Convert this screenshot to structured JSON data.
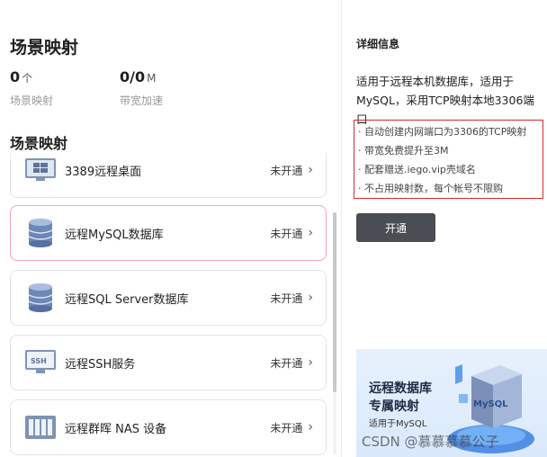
{
  "header": {
    "title": "场景映射"
  },
  "stats": [
    {
      "value": "0",
      "unit": "个",
      "label": "场景映射"
    },
    {
      "value": "0/0",
      "unit": "M",
      "label": "带宽加速"
    }
  ],
  "section": {
    "title": "场景映射"
  },
  "scenarios": [
    {
      "name": "3389远程桌面",
      "status": "未开通",
      "icon": "windows-icon"
    },
    {
      "name": "远程MySQL数据库",
      "status": "未开通",
      "icon": "database-icon"
    },
    {
      "name": "远程SQL Server数据库",
      "status": "未开通",
      "icon": "database-icon"
    },
    {
      "name": "远程SSH服务",
      "status": "未开通",
      "icon": "ssh-monitor-icon"
    },
    {
      "name": "远程群晖 NAS 设备",
      "status": "未开通",
      "icon": "nas-icon"
    }
  ],
  "chevron": "›",
  "detail": {
    "heading": "详细信息",
    "description": "适用于远程本机数据库，适用于MySQL，采用TCP映射本地3306端口",
    "features": [
      "· 自动创建内网端口为3306的TCP映射",
      "· 带宽免费提升至3M",
      "· 配套赠送.iego.vip壳域名",
      "· 不占用映射数，每个帐号不限购"
    ],
    "button_label": "开通"
  },
  "banner": {
    "line1": "远程数据库",
    "line2": "专属映射",
    "line3": "适用于MySQL",
    "product_text": "MySQL"
  },
  "watermark": "CSDN @慕慕慕慕公子",
  "colors": {
    "accent_border": "#f2a5bd",
    "highlight_box": "#d22b2b",
    "button_bg": "#4a4d53"
  }
}
